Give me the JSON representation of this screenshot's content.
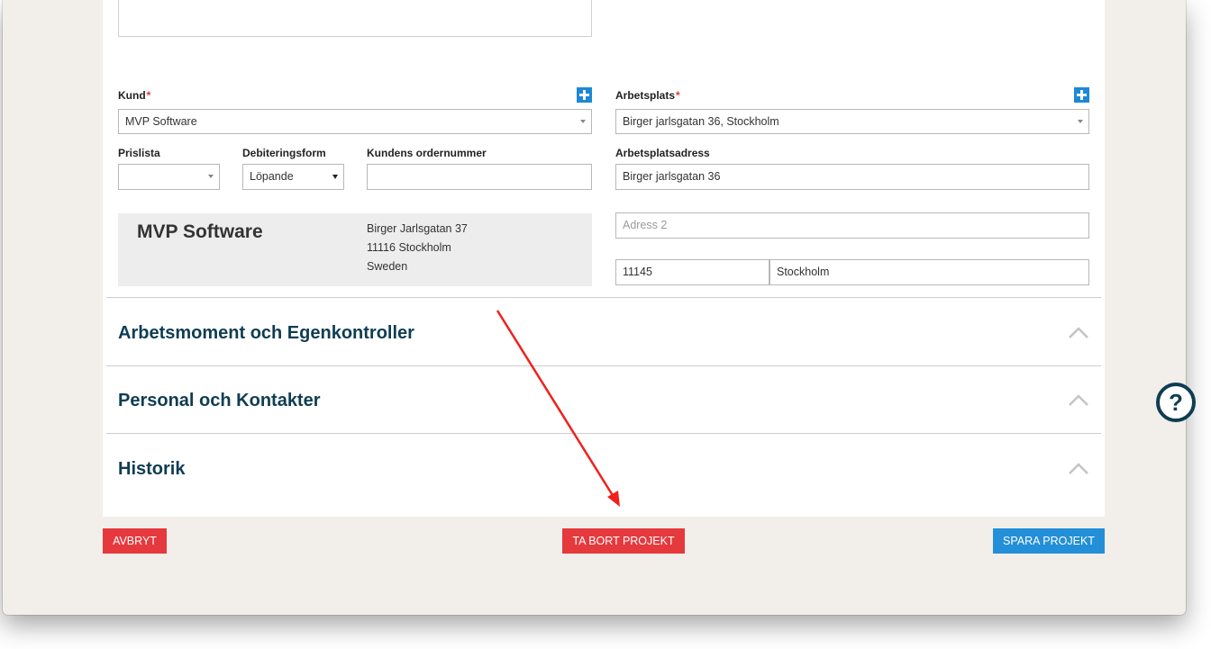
{
  "kund": {
    "label": "Kund",
    "required_mark": "*",
    "value": "MVP Software"
  },
  "arbetsplats": {
    "label": "Arbetsplats",
    "required_mark": "*",
    "value": "Birger jarlsgatan 36, Stockholm"
  },
  "prislista": {
    "label": "Prislista",
    "value": ""
  },
  "debiteringsform": {
    "label": "Debiteringsform",
    "value": "Löpande"
  },
  "kundens_ordernummer": {
    "label": "Kundens ordernummer",
    "value": ""
  },
  "arbetsplatsadress": {
    "label": "Arbetsplatsadress",
    "address1": "Birger jarlsgatan 36",
    "address2_placeholder": "Adress 2",
    "postal_code": "11145",
    "city": "Stockholm"
  },
  "customer_card": {
    "name": "MVP Software",
    "street": "Birger Jarlsgatan 37",
    "postal_city": "11116 Stockholm",
    "country": "Sweden"
  },
  "sections": [
    {
      "title": "Arbetsmoment och Egenkontroller"
    },
    {
      "title": "Personal och Kontakter"
    },
    {
      "title": "Historik"
    }
  ],
  "buttons": {
    "cancel": "AVBRYT",
    "delete": "TA BORT PROJEKT",
    "save": "SPARA PROJEKT"
  },
  "help": {
    "glyph": "?"
  },
  "colors": {
    "accent_blue": "#238fd9",
    "danger_red": "#e6393d",
    "heading_navy": "#0f3d52",
    "annotation_arrow": "#f0201c"
  }
}
